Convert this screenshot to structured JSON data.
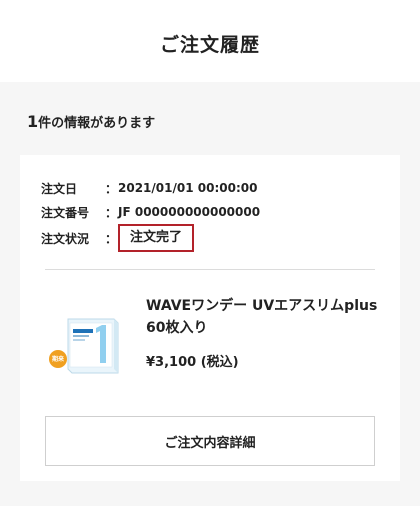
{
  "header": {
    "title": "ご注文履歴"
  },
  "results": {
    "count": "1",
    "suffix": "件の情報があります"
  },
  "order": {
    "date_label": "注文日",
    "date_value": "2021/01/01 00:00:00",
    "number_label": "注文番号",
    "number_value": "JF 000000000000000",
    "status_label": "注文状況",
    "status_value": "注文完了",
    "colon": "："
  },
  "product": {
    "name": "WAVEワンデー UVエアスリムplus 60枚入り",
    "price": "¥3,100 (税込)",
    "badge_text": "期来",
    "image_icon": "contact-lens-box",
    "badge_color": "#f0a020"
  },
  "detail_button": {
    "label": "ご注文内容詳細"
  },
  "colors": {
    "status_border": "#b3222a",
    "page_bg": "#f6f6f6"
  }
}
